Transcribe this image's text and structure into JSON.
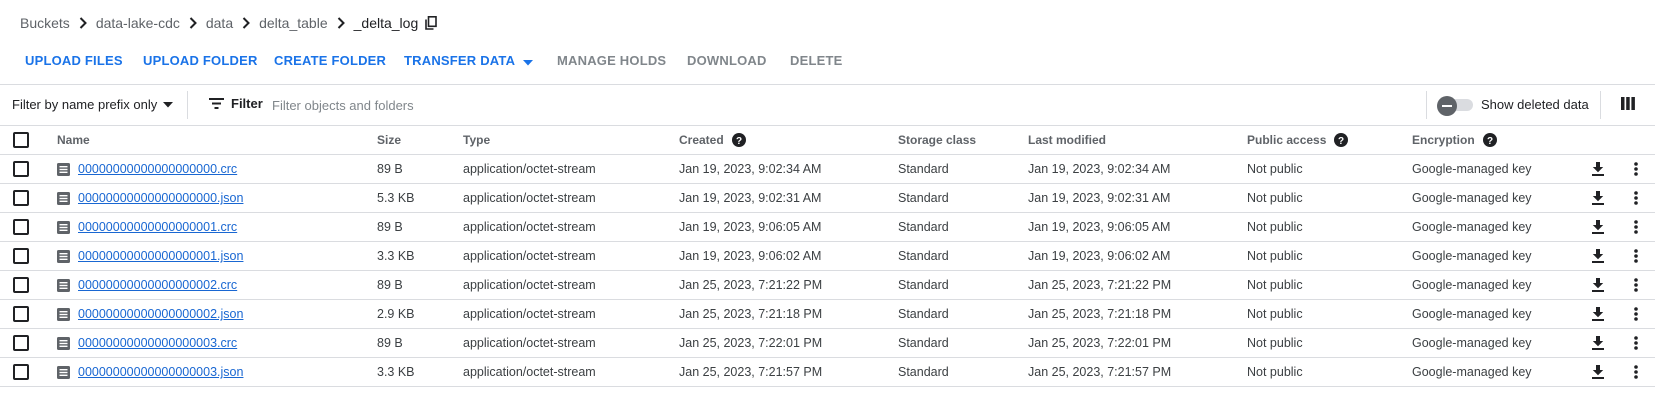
{
  "breadcrumb": {
    "items": [
      "Buckets",
      "data-lake-cdc",
      "data",
      "delta_table"
    ],
    "current": "_delta_log"
  },
  "toolbar": {
    "upload_files": "UPLOAD FILES",
    "upload_folder": "UPLOAD FOLDER",
    "create_folder": "CREATE FOLDER",
    "transfer_data": "TRANSFER DATA",
    "manage_holds": "MANAGE HOLDS",
    "download": "DOWNLOAD",
    "delete": "DELETE"
  },
  "filter": {
    "prefix_label": "Filter by name prefix only",
    "filter_label": "Filter",
    "placeholder": "Filter objects and folders",
    "show_deleted_label": "Show deleted data",
    "show_deleted_on": false
  },
  "table": {
    "columns": {
      "name": "Name",
      "size": "Size",
      "type": "Type",
      "created": "Created",
      "storage_class": "Storage class",
      "last_modified": "Last modified",
      "public_access": "Public access",
      "encryption": "Encryption"
    },
    "rows": [
      {
        "name": "00000000000000000000.crc",
        "size": "89 B",
        "type": "application/octet-stream",
        "created": "Jan 19, 2023, 9:02:34 AM",
        "storage_class": "Standard",
        "last_modified": "Jan 19, 2023, 9:02:34 AM",
        "public_access": "Not public",
        "encryption": "Google-managed key"
      },
      {
        "name": "00000000000000000000.json",
        "size": "5.3 KB",
        "type": "application/octet-stream",
        "created": "Jan 19, 2023, 9:02:31 AM",
        "storage_class": "Standard",
        "last_modified": "Jan 19, 2023, 9:02:31 AM",
        "public_access": "Not public",
        "encryption": "Google-managed key"
      },
      {
        "name": "00000000000000000001.crc",
        "size": "89 B",
        "type": "application/octet-stream",
        "created": "Jan 19, 2023, 9:06:05 AM",
        "storage_class": "Standard",
        "last_modified": "Jan 19, 2023, 9:06:05 AM",
        "public_access": "Not public",
        "encryption": "Google-managed key"
      },
      {
        "name": "00000000000000000001.json",
        "size": "3.3 KB",
        "type": "application/octet-stream",
        "created": "Jan 19, 2023, 9:06:02 AM",
        "storage_class": "Standard",
        "last_modified": "Jan 19, 2023, 9:06:02 AM",
        "public_access": "Not public",
        "encryption": "Google-managed key"
      },
      {
        "name": "00000000000000000002.crc",
        "size": "89 B",
        "type": "application/octet-stream",
        "created": "Jan 25, 2023, 7:21:22 PM",
        "storage_class": "Standard",
        "last_modified": "Jan 25, 2023, 7:21:22 PM",
        "public_access": "Not public",
        "encryption": "Google-managed key"
      },
      {
        "name": "00000000000000000002.json",
        "size": "2.9 KB",
        "type": "application/octet-stream",
        "created": "Jan 25, 2023, 7:21:18 PM",
        "storage_class": "Standard",
        "last_modified": "Jan 25, 2023, 7:21:18 PM",
        "public_access": "Not public",
        "encryption": "Google-managed key"
      },
      {
        "name": "00000000000000000003.crc",
        "size": "89 B",
        "type": "application/octet-stream",
        "created": "Jan 25, 2023, 7:22:01 PM",
        "storage_class": "Standard",
        "last_modified": "Jan 25, 2023, 7:22:01 PM",
        "public_access": "Not public",
        "encryption": "Google-managed key"
      },
      {
        "name": "00000000000000000003.json",
        "size": "3.3 KB",
        "type": "application/octet-stream",
        "created": "Jan 25, 2023, 7:21:57 PM",
        "storage_class": "Standard",
        "last_modified": "Jan 25, 2023, 7:21:57 PM",
        "public_access": "Not public",
        "encryption": "Google-managed key"
      }
    ]
  },
  "icons": {
    "breadcrumb_separator": "chevron-right-icon",
    "copy": "copy-icon",
    "dropdown": "arrow-drop-down-icon",
    "filter": "filter-list-icon",
    "help": "help-icon",
    "file": "file-icon",
    "download": "download-icon",
    "more": "more-vert-icon",
    "columns": "column-display-icon"
  },
  "colors": {
    "accent": "#1a73e8",
    "link": "#1967d2",
    "disabled": "#80868b",
    "divider": "#dadce0"
  }
}
